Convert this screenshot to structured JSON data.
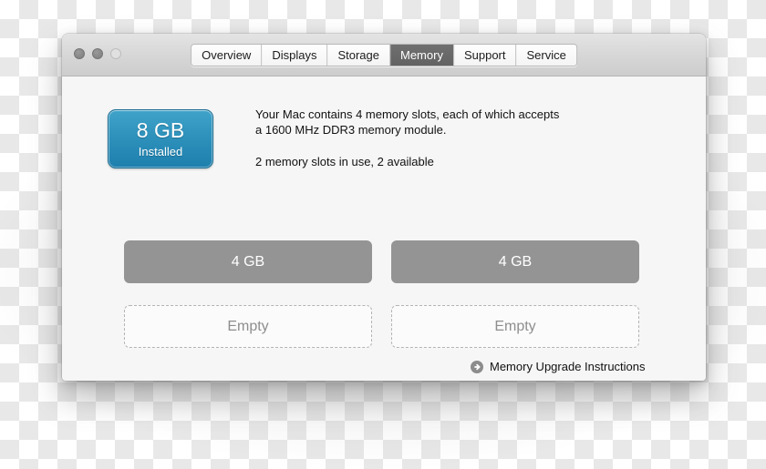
{
  "window": {
    "traffic_lights": [
      {
        "name": "close-button",
        "state": "inactive"
      },
      {
        "name": "minimize-button",
        "state": "inactive"
      },
      {
        "name": "zoom-button",
        "state": "inactive-hollow"
      }
    ],
    "tabs": [
      {
        "label": "Overview",
        "selected": false
      },
      {
        "label": "Displays",
        "selected": false
      },
      {
        "label": "Storage",
        "selected": false
      },
      {
        "label": "Memory",
        "selected": true
      },
      {
        "label": "Support",
        "selected": false
      },
      {
        "label": "Service",
        "selected": false
      }
    ]
  },
  "memory": {
    "badge": {
      "size": "8 GB",
      "state": "Installed"
    },
    "description_line1": "Your Mac contains 4 memory slots, each of which accepts",
    "description_line2": "a 1600 MHz DDR3 memory module.",
    "slots_summary": "2 memory slots in use, 2 available",
    "slots": [
      {
        "label": "4 GB",
        "occupied": true
      },
      {
        "label": "4 GB",
        "occupied": true
      },
      {
        "label": "Empty",
        "occupied": false
      },
      {
        "label": "Empty",
        "occupied": false
      }
    ],
    "upgrade_link": {
      "label": "Memory Upgrade Instructions",
      "icon": "circle-arrow-right-icon"
    }
  },
  "colors": {
    "accent_blue_top": "#3fa3c9",
    "accent_blue_bottom": "#1e7fad",
    "slot_filled_gray": "#949494",
    "slot_empty_border": "#b3b3b3",
    "tab_selected_bg": "#6b6b6b",
    "window_bg": "#f6f6f6",
    "titlebar_bg": "#d6d6d6"
  }
}
